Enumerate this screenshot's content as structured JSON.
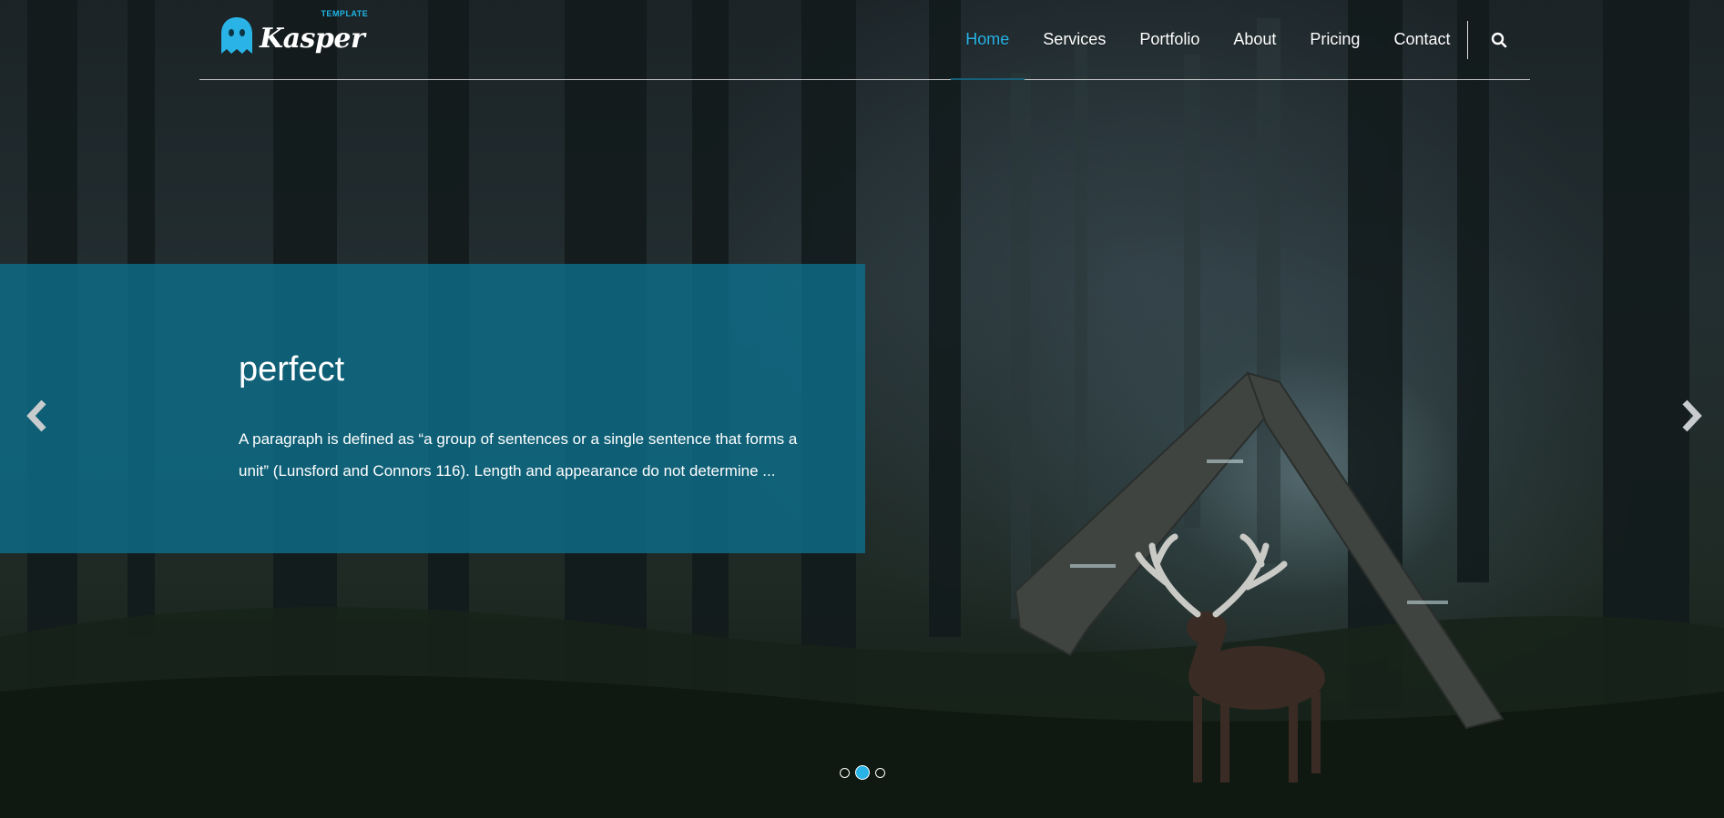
{
  "brand": {
    "name": "Kasper",
    "tagline": "TEMPLATE",
    "accent_color": "#29b3e6"
  },
  "nav": {
    "items": [
      {
        "label": "Home",
        "active": true
      },
      {
        "label": "Services",
        "active": false
      },
      {
        "label": "Portfolio",
        "active": false
      },
      {
        "label": "About",
        "active": false
      },
      {
        "label": "Pricing",
        "active": false
      },
      {
        "label": "Contact",
        "active": false
      }
    ],
    "search_icon": "search-icon"
  },
  "slide": {
    "title": "perfect",
    "text": "A paragraph is defined as “a group of sentences or a single sentence that forms a unit” (Lunsford and Connors 116). Length and appearance do not determine ...",
    "panel_color": "#0e6e8a"
  },
  "slider": {
    "prev_icon": "chevron-left-icon",
    "next_icon": "chevron-right-icon",
    "dots": [
      {
        "active": false
      },
      {
        "active": true
      },
      {
        "active": false
      }
    ]
  }
}
